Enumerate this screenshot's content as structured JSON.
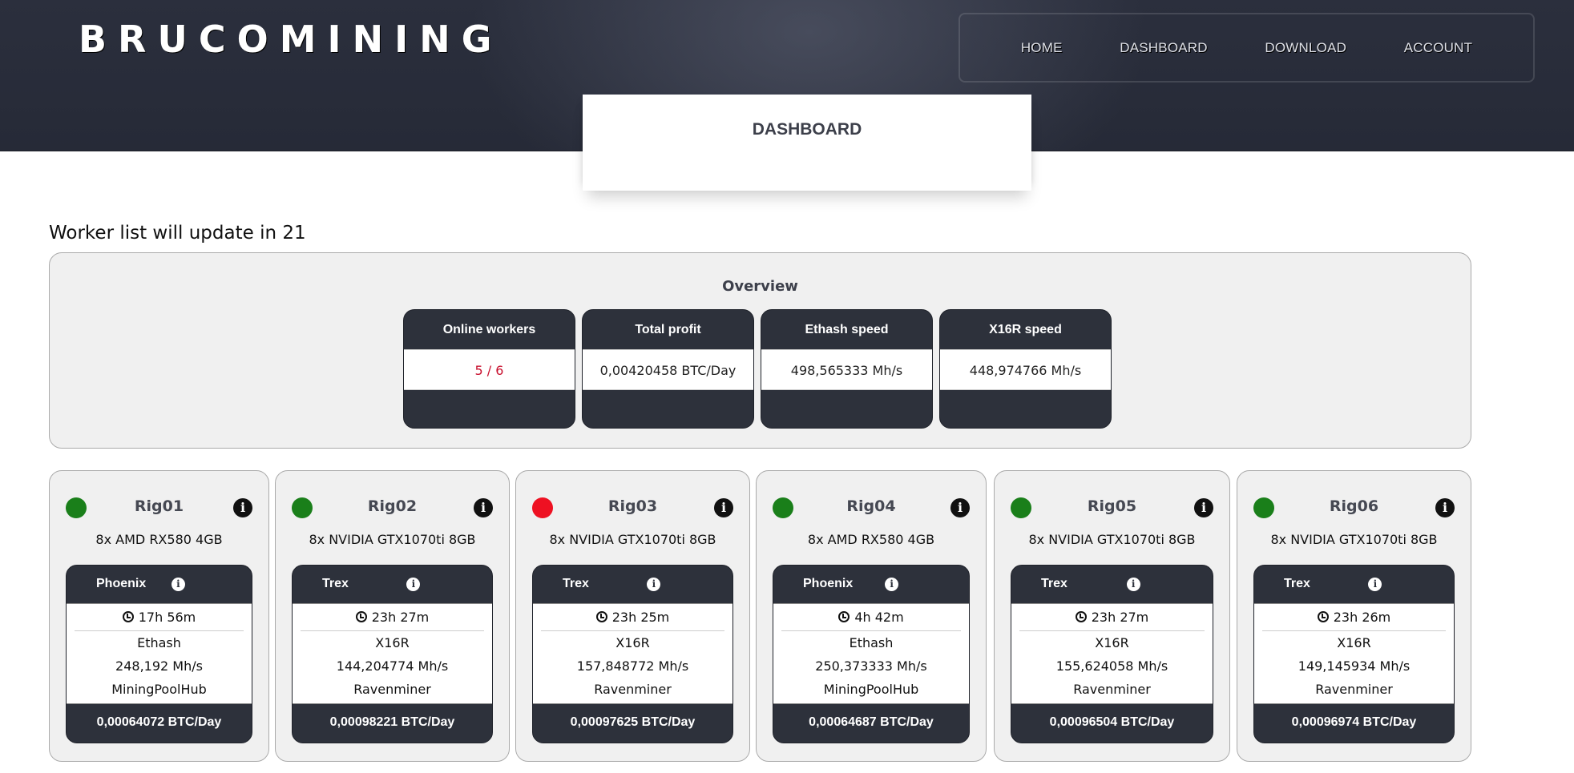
{
  "header": {
    "logo": "BRUCOMINING",
    "nav": [
      "HOME",
      "DASHBOARD",
      "DOWNLOAD",
      "ACCOUNT"
    ]
  },
  "page_title": "DASHBOARD",
  "update_text": "Worker list will update in 21",
  "overview": {
    "title": "Overview",
    "stats": [
      {
        "label": "Online workers",
        "value": "5 / 6"
      },
      {
        "label": "Total profit",
        "value": "0,00420458 BTC/Day"
      },
      {
        "label": "Ethash speed",
        "value": "498,565333 Mh/s"
      },
      {
        "label": "X16R speed",
        "value": "448,974766 Mh/s"
      }
    ]
  },
  "colors": {
    "online": "#1a7f1a",
    "offline": "#ee1122",
    "dark": "#2d313b"
  },
  "rigs": [
    {
      "name": "Rig01",
      "status": "online",
      "gpu": "8x AMD RX580 4GB",
      "miner": "Phoenix",
      "uptime": "17h 56m",
      "algo": "Ethash",
      "speed": "248,192 Mh/s",
      "pool": "MiningPoolHub",
      "profit": "0,00064072 BTC/Day"
    },
    {
      "name": "Rig02",
      "status": "online",
      "gpu": "8x NVIDIA GTX1070ti 8GB",
      "miner": "Trex",
      "uptime": "23h 27m",
      "algo": "X16R",
      "speed": "144,204774 Mh/s",
      "pool": "Ravenminer",
      "profit": "0,00098221 BTC/Day"
    },
    {
      "name": "Rig03",
      "status": "offline",
      "gpu": "8x NVIDIA GTX1070ti 8GB",
      "miner": "Trex",
      "uptime": "23h 25m",
      "algo": "X16R",
      "speed": "157,848772 Mh/s",
      "pool": "Ravenminer",
      "profit": "0,00097625 BTC/Day"
    },
    {
      "name": "Rig04",
      "status": "online",
      "gpu": "8x AMD RX580 4GB",
      "miner": "Phoenix",
      "uptime": "4h 42m",
      "algo": "Ethash",
      "speed": "250,373333 Mh/s",
      "pool": "MiningPoolHub",
      "profit": "0,00064687 BTC/Day"
    },
    {
      "name": "Rig05",
      "status": "online",
      "gpu": "8x NVIDIA GTX1070ti 8GB",
      "miner": "Trex",
      "uptime": "23h 27m",
      "algo": "X16R",
      "speed": "155,624058 Mh/s",
      "pool": "Ravenminer",
      "profit": "0,00096504 BTC/Day"
    },
    {
      "name": "Rig06",
      "status": "online",
      "gpu": "8x NVIDIA GTX1070ti 8GB",
      "miner": "Trex",
      "uptime": "23h 26m",
      "algo": "X16R",
      "speed": "149,145934 Mh/s",
      "pool": "Ravenminer",
      "profit": "0,00096974 BTC/Day"
    }
  ]
}
